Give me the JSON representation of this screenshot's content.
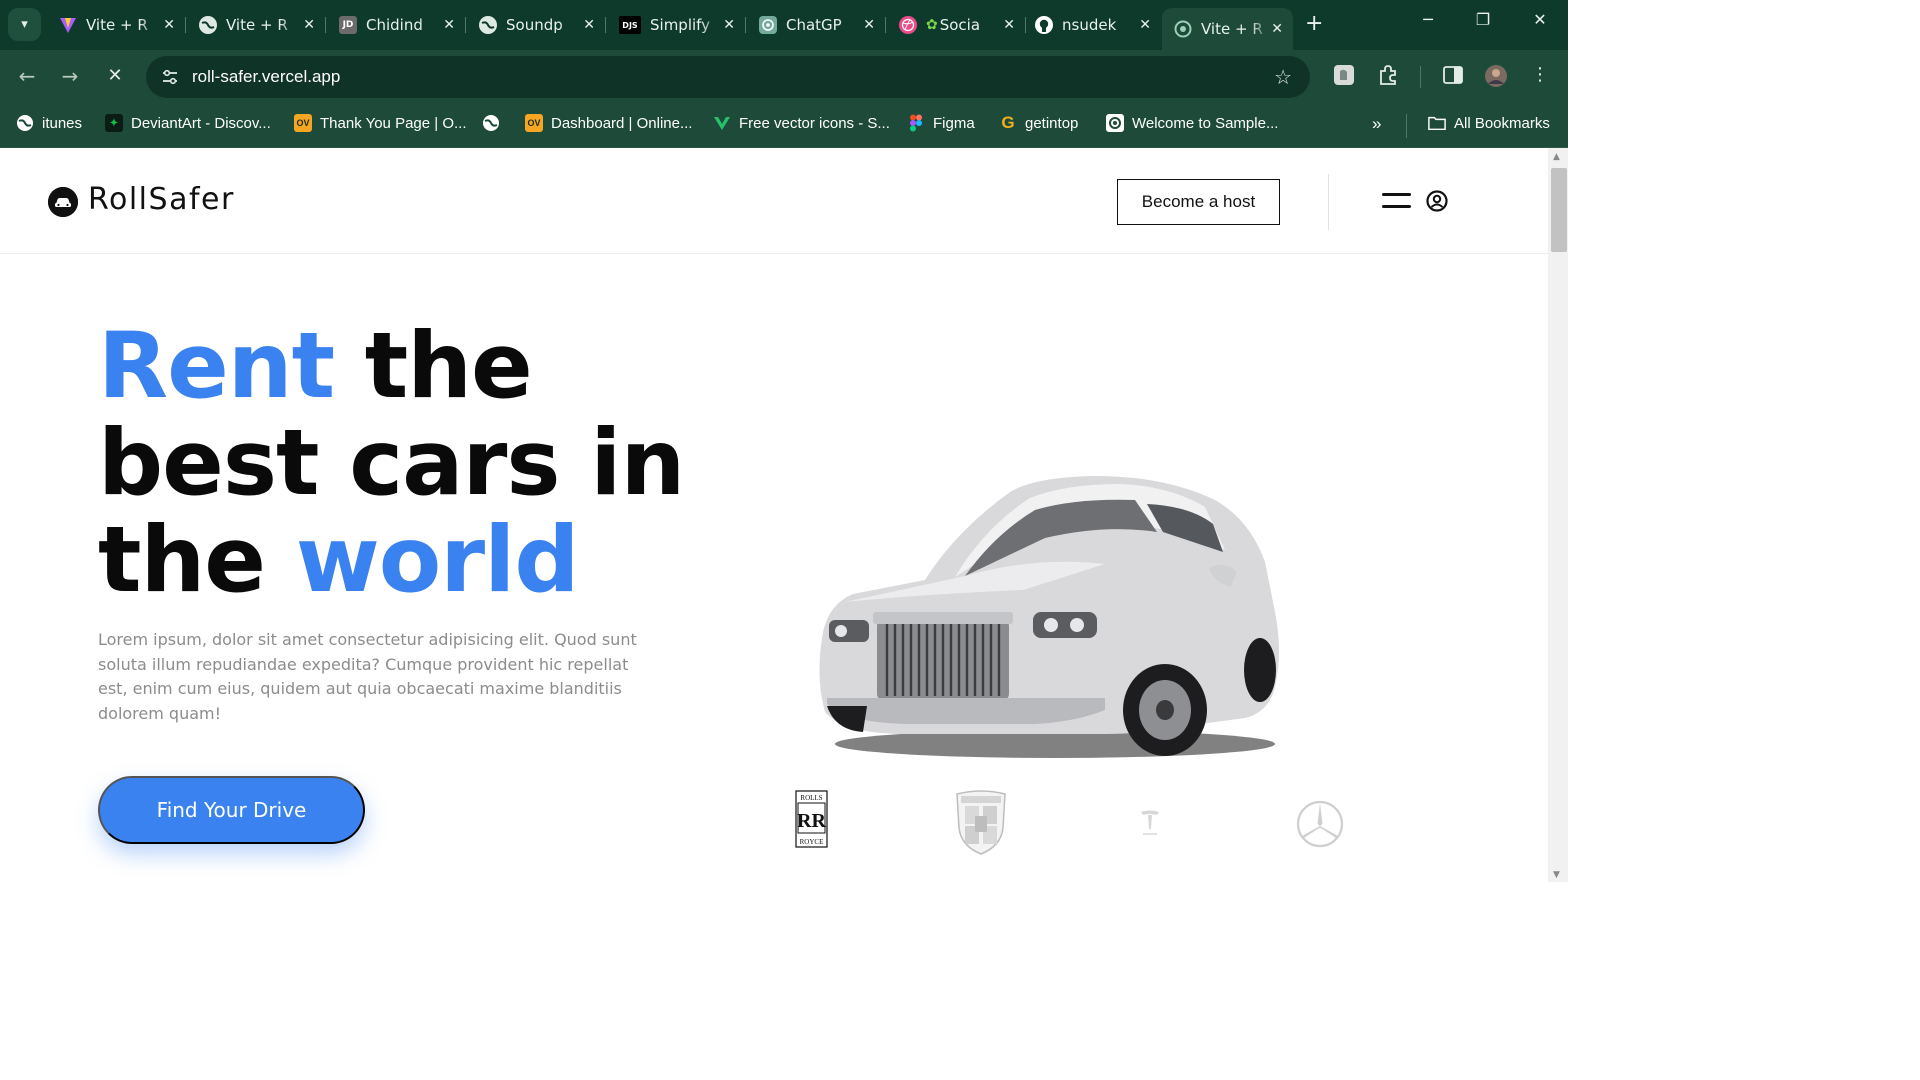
{
  "browser": {
    "tabs": [
      {
        "title": "Vite + R",
        "icon": "vite-icon",
        "active": false
      },
      {
        "title": "Vite + R",
        "icon": "globe-icon",
        "active": false
      },
      {
        "title": "Chidind",
        "icon": "jd-icon",
        "active": false
      },
      {
        "title": "Soundp",
        "icon": "globe-icon",
        "active": false
      },
      {
        "title": "Simplify",
        "icon": "djs-icon",
        "active": false
      },
      {
        "title": "ChatGP",
        "icon": "chatgpt-icon",
        "active": false
      },
      {
        "title": "Socia",
        "icon": "dribbble-icon",
        "active": false
      },
      {
        "title": "nsudek",
        "icon": "github-icon",
        "active": false
      },
      {
        "title": "Vite + R",
        "icon": "vercel-icon",
        "active": true
      }
    ],
    "jd_badge": "JD",
    "djs_badge": "DJS",
    "url": "roll-safer.vercel.app",
    "bookmarks": [
      {
        "label": "itunes",
        "icon": "globe-icon"
      },
      {
        "label": "DeviantArt - Discov...",
        "icon": "deviantart-icon"
      },
      {
        "label": "Thank You Page | O...",
        "icon": "ov-icon"
      },
      {
        "label": "",
        "icon": "globe-icon"
      },
      {
        "label": "Dashboard | Online...",
        "icon": "ov-icon"
      },
      {
        "label": "Free vector icons - S...",
        "icon": "vector-icon"
      },
      {
        "label": "Figma",
        "icon": "figma-icon"
      },
      {
        "label": "getintop",
        "icon": "getintop-icon"
      },
      {
        "label": "Welcome to Sample...",
        "icon": "camera-icon"
      }
    ],
    "ov_badge": "OV",
    "all_bookmarks": "All Bookmarks",
    "colors": {
      "chrome": "#0e3a2b",
      "toolbar": "#1d4a39"
    }
  },
  "site": {
    "logo_text": "RollSafer",
    "host_button": "Become a host",
    "hero": {
      "title_word_1": "Rent",
      "title_rest_1": " the",
      "title_line_2": "best cars in",
      "title_line_3_start": "the ",
      "title_word_accent": "world",
      "description": "Lorem ipsum, dolor sit amet consectetur adipisicing elit. Quod sunt soluta illum repudiandae expedita? Cumque provident hic repellat est, enim cum eius, quidem aut quia obcaecati maxime blanditiis dolorem quam!",
      "cta": "Find Your Drive"
    },
    "brand_logos": [
      "rolls-royce-logo",
      "porsche-logo",
      "tesla-logo",
      "mercedes-logo"
    ],
    "rolls_royce_text": {
      "top": "ROLLS",
      "mono": "RR",
      "bottom": "ROYCE"
    },
    "colors": {
      "accent": "#3a82f0",
      "text": "#0a0a0a",
      "muted": "#8c8c8c"
    }
  }
}
